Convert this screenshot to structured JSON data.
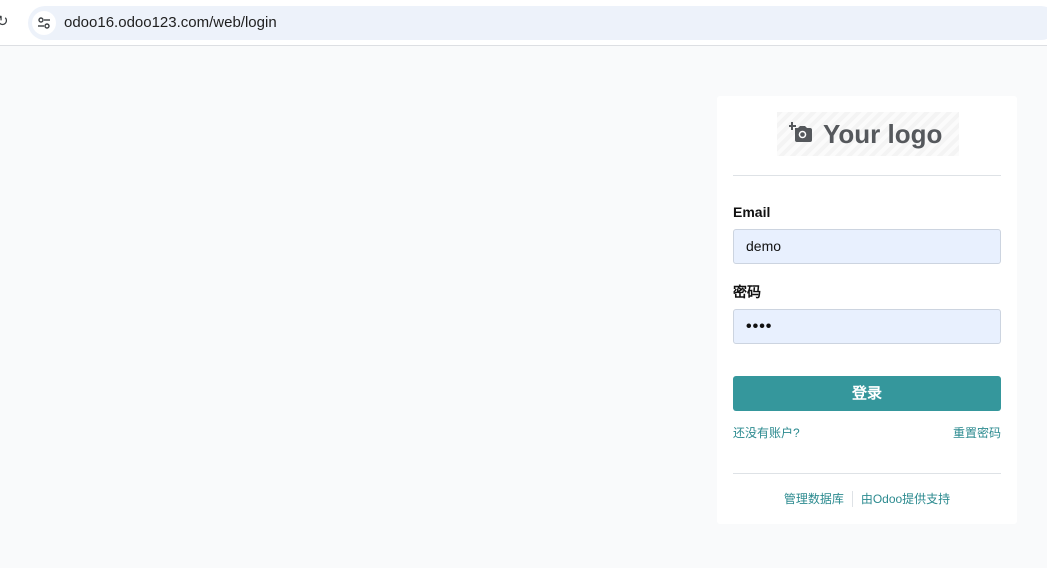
{
  "browser": {
    "url": "odoo16.odoo123.com/web/login"
  },
  "login": {
    "logo_text": "Your logo",
    "email_label": "Email",
    "email_value": "demo",
    "password_label": "密码",
    "password_mask": "••••",
    "submit_label": "登录",
    "signup_link": "还没有账户?",
    "reset_link": "重置密码"
  },
  "footer": {
    "manage_db": "管理数据库",
    "powered_by": "由Odoo提供支持"
  },
  "colors": {
    "primary": "#35979c",
    "link": "#2b8a8f",
    "input_bg": "#e8f0fe"
  }
}
